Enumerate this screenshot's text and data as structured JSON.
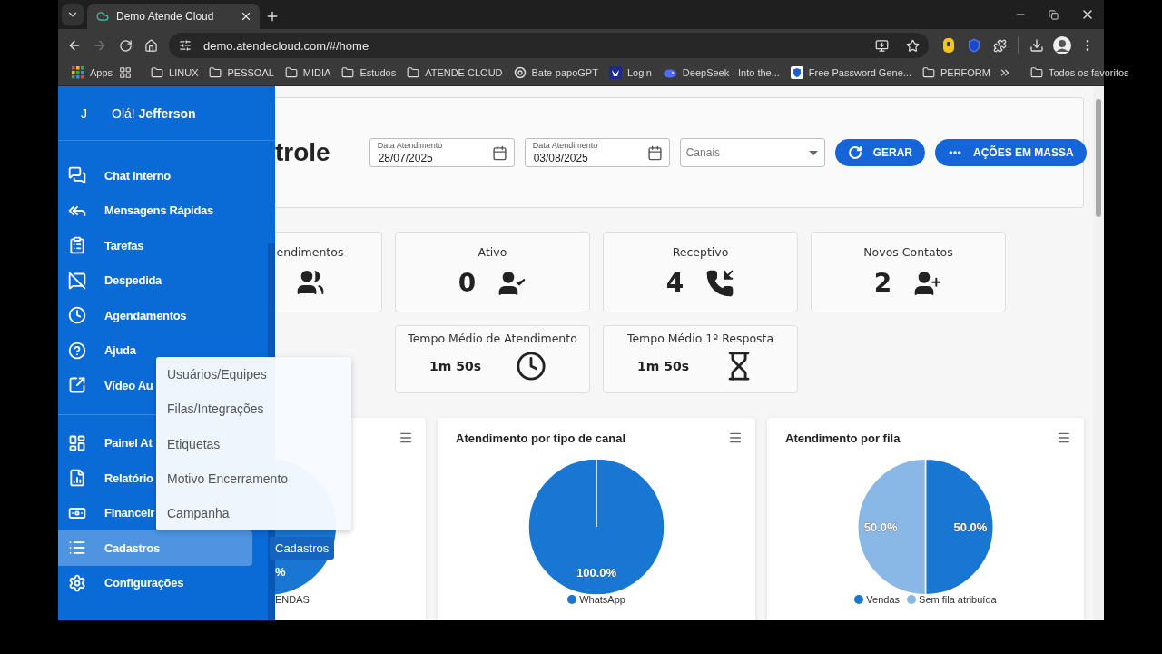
{
  "browser": {
    "tab_title": "Demo Atende Cloud",
    "url": "demo.atendecloud.com/#/home",
    "bookmarks": [
      {
        "label": "Apps",
        "kind": "apps"
      },
      {
        "label": "LINUX",
        "kind": "folder"
      },
      {
        "label": "PESSOAL",
        "kind": "folder"
      },
      {
        "label": "MIDIA",
        "kind": "folder"
      },
      {
        "label": "Estudos",
        "kind": "folder"
      },
      {
        "label": "ATENDE CLOUD",
        "kind": "folder"
      },
      {
        "label": "Bate-papoGPT",
        "kind": "knot"
      },
      {
        "label": "Login",
        "kind": "bird"
      },
      {
        "label": "DeepSeek - Into the...",
        "kind": "whale"
      },
      {
        "label": "Free Password Gene...",
        "kind": "shield"
      },
      {
        "label": "PERFORM",
        "kind": "folder"
      }
    ],
    "all_bookmarks": "Todos os favoritos"
  },
  "sidebar": {
    "user_initial": "J",
    "greeting": "Olá! **Jefferson**",
    "sections": [
      {
        "items": [
          {
            "label": "Chat Interno",
            "kind": "chat",
            "selected": false
          },
          {
            "label": "Mensagens Rápidas",
            "kind": "reply",
            "selected": false
          },
          {
            "label": "Tarefas",
            "kind": "tasks",
            "selected": false
          },
          {
            "label": "Despedida",
            "kind": "farewell",
            "selected": false
          },
          {
            "label": "Agendamentos",
            "kind": "schedule",
            "selected": false
          },
          {
            "label": "Ajuda",
            "kind": "help",
            "selected": false
          },
          {
            "label": "Vídeo Au",
            "kind": "video",
            "selected": false
          }
        ]
      },
      {
        "items": [
          {
            "label": "Painel At",
            "kind": "panel",
            "selected": false
          },
          {
            "label": "Relatório",
            "kind": "reports",
            "selected": false
          },
          {
            "label": "Financeir",
            "kind": "finance",
            "selected": false
          },
          {
            "label": "Cadastros",
            "kind": "registry",
            "selected": true
          },
          {
            "label": "Configurações",
            "kind": "settings",
            "selected": false
          }
        ]
      }
    ]
  },
  "submenu": [
    "Usuários/Equipes",
    "Filas/Integrações",
    "Etiquetas",
    "Motivo Encerramento",
    "Campanha"
  ],
  "tooltip": "Cadastros",
  "header": {
    "title": "trole",
    "date_fields": [
      {
        "label": "Data Atendimento",
        "value": "28/07/2025"
      },
      {
        "label": "Data Atendimento",
        "value": "03/08/2025"
      }
    ],
    "channel_select": {
      "placeholder": "Canais"
    },
    "buttons": [
      {
        "label": "GERAR",
        "kind": "refresh"
      },
      {
        "label": "AÇÕES EM MASSA",
        "kind": "dots"
      }
    ]
  },
  "stats": [
    {
      "title": "endimentos",
      "kind": "group"
    },
    {
      "title": "Ativo",
      "value": "0",
      "kind": "person-check"
    },
    {
      "title": "Receptivo",
      "value": "4",
      "kind": "call-in"
    },
    {
      "title": "Novos Contatos",
      "value": "2",
      "kind": "person-add"
    }
  ],
  "times": [
    {
      "title": "Tempo Médio de Atendimento",
      "value": "1m 50s",
      "kind": "clock"
    },
    {
      "title": "Tempo Médio 1º Resposta",
      "value": "1m 50s",
      "kind": "hourglass"
    }
  ],
  "charts": [
    {
      "kind": "partial",
      "label": "%",
      "legend": "ENDAS"
    },
    {
      "kind": "pie",
      "chart_data": {
        "type": "pie",
        "title": "Atendimento por tipo de canal",
        "categories": [
          "WhatsApp"
        ],
        "colors": [
          "#1976d2"
        ],
        "values": [
          100
        ],
        "data_labels": true,
        "value_labels": [
          "100.0%"
        ],
        "legend": "bottom"
      }
    },
    {
      "kind": "pie",
      "chart_data": {
        "type": "pie",
        "title": "Atendimento por fila",
        "categories": [
          "Vendas",
          "Sem fila atribuída"
        ],
        "colors": [
          "#1976d2",
          "#8ab8e6"
        ],
        "values": [
          50,
          50
        ],
        "data_labels": true,
        "value_labels": [
          "50.0%",
          "50.0%"
        ],
        "legend": "bottom"
      }
    }
  ]
}
